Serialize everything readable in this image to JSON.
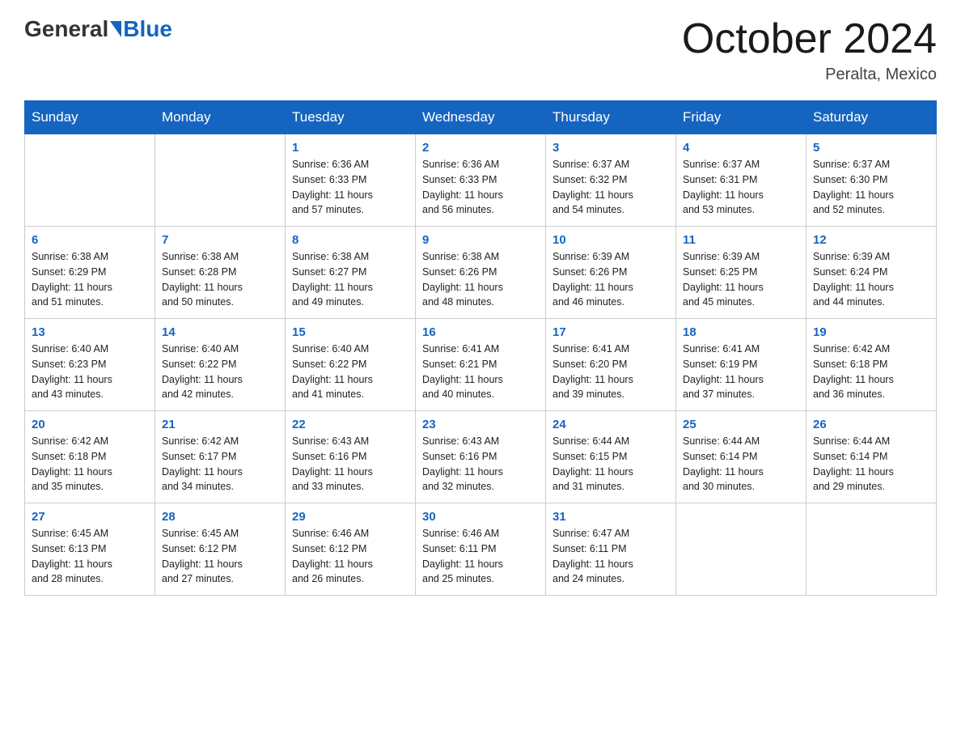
{
  "header": {
    "logo": {
      "general": "General",
      "blue": "Blue"
    },
    "title": "October 2024",
    "location": "Peralta, Mexico"
  },
  "calendar": {
    "weekdays": [
      "Sunday",
      "Monday",
      "Tuesday",
      "Wednesday",
      "Thursday",
      "Friday",
      "Saturday"
    ],
    "weeks": [
      [
        {
          "day": "",
          "info": ""
        },
        {
          "day": "",
          "info": ""
        },
        {
          "day": "1",
          "info": "Sunrise: 6:36 AM\nSunset: 6:33 PM\nDaylight: 11 hours\nand 57 minutes."
        },
        {
          "day": "2",
          "info": "Sunrise: 6:36 AM\nSunset: 6:33 PM\nDaylight: 11 hours\nand 56 minutes."
        },
        {
          "day": "3",
          "info": "Sunrise: 6:37 AM\nSunset: 6:32 PM\nDaylight: 11 hours\nand 54 minutes."
        },
        {
          "day": "4",
          "info": "Sunrise: 6:37 AM\nSunset: 6:31 PM\nDaylight: 11 hours\nand 53 minutes."
        },
        {
          "day": "5",
          "info": "Sunrise: 6:37 AM\nSunset: 6:30 PM\nDaylight: 11 hours\nand 52 minutes."
        }
      ],
      [
        {
          "day": "6",
          "info": "Sunrise: 6:38 AM\nSunset: 6:29 PM\nDaylight: 11 hours\nand 51 minutes."
        },
        {
          "day": "7",
          "info": "Sunrise: 6:38 AM\nSunset: 6:28 PM\nDaylight: 11 hours\nand 50 minutes."
        },
        {
          "day": "8",
          "info": "Sunrise: 6:38 AM\nSunset: 6:27 PM\nDaylight: 11 hours\nand 49 minutes."
        },
        {
          "day": "9",
          "info": "Sunrise: 6:38 AM\nSunset: 6:26 PM\nDaylight: 11 hours\nand 48 minutes."
        },
        {
          "day": "10",
          "info": "Sunrise: 6:39 AM\nSunset: 6:26 PM\nDaylight: 11 hours\nand 46 minutes."
        },
        {
          "day": "11",
          "info": "Sunrise: 6:39 AM\nSunset: 6:25 PM\nDaylight: 11 hours\nand 45 minutes."
        },
        {
          "day": "12",
          "info": "Sunrise: 6:39 AM\nSunset: 6:24 PM\nDaylight: 11 hours\nand 44 minutes."
        }
      ],
      [
        {
          "day": "13",
          "info": "Sunrise: 6:40 AM\nSunset: 6:23 PM\nDaylight: 11 hours\nand 43 minutes."
        },
        {
          "day": "14",
          "info": "Sunrise: 6:40 AM\nSunset: 6:22 PM\nDaylight: 11 hours\nand 42 minutes."
        },
        {
          "day": "15",
          "info": "Sunrise: 6:40 AM\nSunset: 6:22 PM\nDaylight: 11 hours\nand 41 minutes."
        },
        {
          "day": "16",
          "info": "Sunrise: 6:41 AM\nSunset: 6:21 PM\nDaylight: 11 hours\nand 40 minutes."
        },
        {
          "day": "17",
          "info": "Sunrise: 6:41 AM\nSunset: 6:20 PM\nDaylight: 11 hours\nand 39 minutes."
        },
        {
          "day": "18",
          "info": "Sunrise: 6:41 AM\nSunset: 6:19 PM\nDaylight: 11 hours\nand 37 minutes."
        },
        {
          "day": "19",
          "info": "Sunrise: 6:42 AM\nSunset: 6:18 PM\nDaylight: 11 hours\nand 36 minutes."
        }
      ],
      [
        {
          "day": "20",
          "info": "Sunrise: 6:42 AM\nSunset: 6:18 PM\nDaylight: 11 hours\nand 35 minutes."
        },
        {
          "day": "21",
          "info": "Sunrise: 6:42 AM\nSunset: 6:17 PM\nDaylight: 11 hours\nand 34 minutes."
        },
        {
          "day": "22",
          "info": "Sunrise: 6:43 AM\nSunset: 6:16 PM\nDaylight: 11 hours\nand 33 minutes."
        },
        {
          "day": "23",
          "info": "Sunrise: 6:43 AM\nSunset: 6:16 PM\nDaylight: 11 hours\nand 32 minutes."
        },
        {
          "day": "24",
          "info": "Sunrise: 6:44 AM\nSunset: 6:15 PM\nDaylight: 11 hours\nand 31 minutes."
        },
        {
          "day": "25",
          "info": "Sunrise: 6:44 AM\nSunset: 6:14 PM\nDaylight: 11 hours\nand 30 minutes."
        },
        {
          "day": "26",
          "info": "Sunrise: 6:44 AM\nSunset: 6:14 PM\nDaylight: 11 hours\nand 29 minutes."
        }
      ],
      [
        {
          "day": "27",
          "info": "Sunrise: 6:45 AM\nSunset: 6:13 PM\nDaylight: 11 hours\nand 28 minutes."
        },
        {
          "day": "28",
          "info": "Sunrise: 6:45 AM\nSunset: 6:12 PM\nDaylight: 11 hours\nand 27 minutes."
        },
        {
          "day": "29",
          "info": "Sunrise: 6:46 AM\nSunset: 6:12 PM\nDaylight: 11 hours\nand 26 minutes."
        },
        {
          "day": "30",
          "info": "Sunrise: 6:46 AM\nSunset: 6:11 PM\nDaylight: 11 hours\nand 25 minutes."
        },
        {
          "day": "31",
          "info": "Sunrise: 6:47 AM\nSunset: 6:11 PM\nDaylight: 11 hours\nand 24 minutes."
        },
        {
          "day": "",
          "info": ""
        },
        {
          "day": "",
          "info": ""
        }
      ]
    ]
  }
}
